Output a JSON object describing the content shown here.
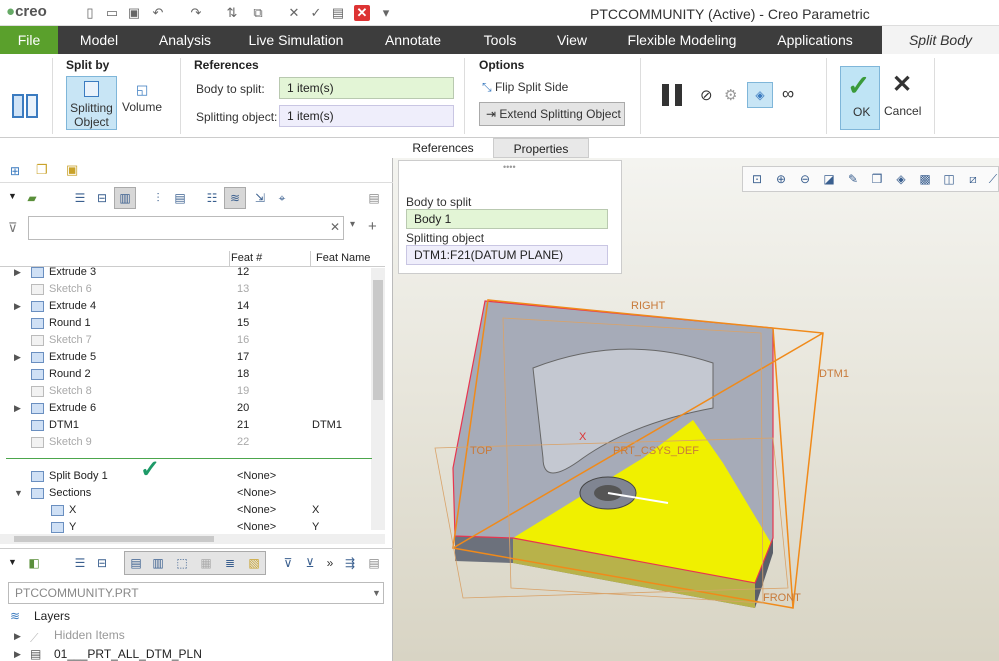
{
  "title_bar": {
    "logo": "creo",
    "window_title": "PTCCOMMUNITY (Active) - Creo Parametric"
  },
  "menu": [
    "File",
    "Model",
    "Analysis",
    "Live Simulation",
    "Annotate",
    "Tools",
    "View",
    "Flexible Modeling",
    "Applications",
    "Split Body"
  ],
  "ribbon": {
    "split_by": {
      "title": "Split by",
      "splitting_object": "Splitting Object",
      "volume": "Volume"
    },
    "references": {
      "title": "References",
      "body_label": "Body to split:",
      "body_value": "1 item(s)",
      "object_label": "Splitting object:",
      "object_value": "1 item(s)"
    },
    "options": {
      "title": "Options",
      "flip": "Flip Split Side",
      "extend": "Extend Splitting Object"
    },
    "ok": "OK",
    "cancel": "Cancel"
  },
  "panel_tabs": [
    "References",
    "Properties"
  ],
  "ref_panel": {
    "body_label": "Body to split",
    "body_value": "Body 1",
    "object_label": "Splitting object",
    "object_value": "DTM1:F21(DATUM PLANE)"
  },
  "tree": {
    "col_feat": "Feat #",
    "col_name": "Feat Name",
    "rows": [
      {
        "name": "Extrude 3",
        "num": "12",
        "fname": "",
        "grey": false,
        "exp": true
      },
      {
        "name": "Sketch 6",
        "num": "13",
        "fname": "",
        "grey": true,
        "exp": false
      },
      {
        "name": "Extrude 4",
        "num": "14",
        "fname": "",
        "grey": false,
        "exp": true
      },
      {
        "name": "Round 1",
        "num": "15",
        "fname": "",
        "grey": false,
        "exp": false
      },
      {
        "name": "Sketch 7",
        "num": "16",
        "fname": "",
        "grey": true,
        "exp": false
      },
      {
        "name": "Extrude 5",
        "num": "17",
        "fname": "",
        "grey": false,
        "exp": true
      },
      {
        "name": "Round 2",
        "num": "18",
        "fname": "",
        "grey": false,
        "exp": false
      },
      {
        "name": "Sketch 8",
        "num": "19",
        "fname": "",
        "grey": true,
        "exp": false
      },
      {
        "name": "Extrude 6",
        "num": "20",
        "fname": "",
        "grey": false,
        "exp": true
      },
      {
        "name": "DTM1",
        "num": "21",
        "fname": "DTM1",
        "grey": false,
        "exp": false
      },
      {
        "name": "Sketch 9",
        "num": "22",
        "fname": "",
        "grey": true,
        "exp": false
      }
    ],
    "split_body": {
      "name": "Split Body 1",
      "num": "<None>"
    },
    "sections": {
      "name": "Sections",
      "num": "<None>"
    },
    "section_rows": [
      {
        "name": "X",
        "num": "<None>",
        "fname": "X"
      },
      {
        "name": "Y",
        "num": "<None>",
        "fname": "Y"
      }
    ]
  },
  "layers": {
    "dropdown": "PTCCOMMUNITY.PRT",
    "title": "Layers",
    "hidden": "Hidden Items",
    "item": "01___PRT_ALL_DTM_PLN"
  },
  "model_labels": {
    "right": "RIGHT",
    "dtm1": "DTM1",
    "top": "TOP",
    "csys": "PRT_CSYS_DEF",
    "x": "X",
    "front": "FRONT"
  },
  "colors": {
    "menu_bg": "#3d3d3d",
    "file_green": "#5aa02c",
    "highlight": "#f5ef3a",
    "ok_bg": "#bfe4f5",
    "body_yellow": "#f0f000",
    "datum_orange": "#f08a1a"
  }
}
